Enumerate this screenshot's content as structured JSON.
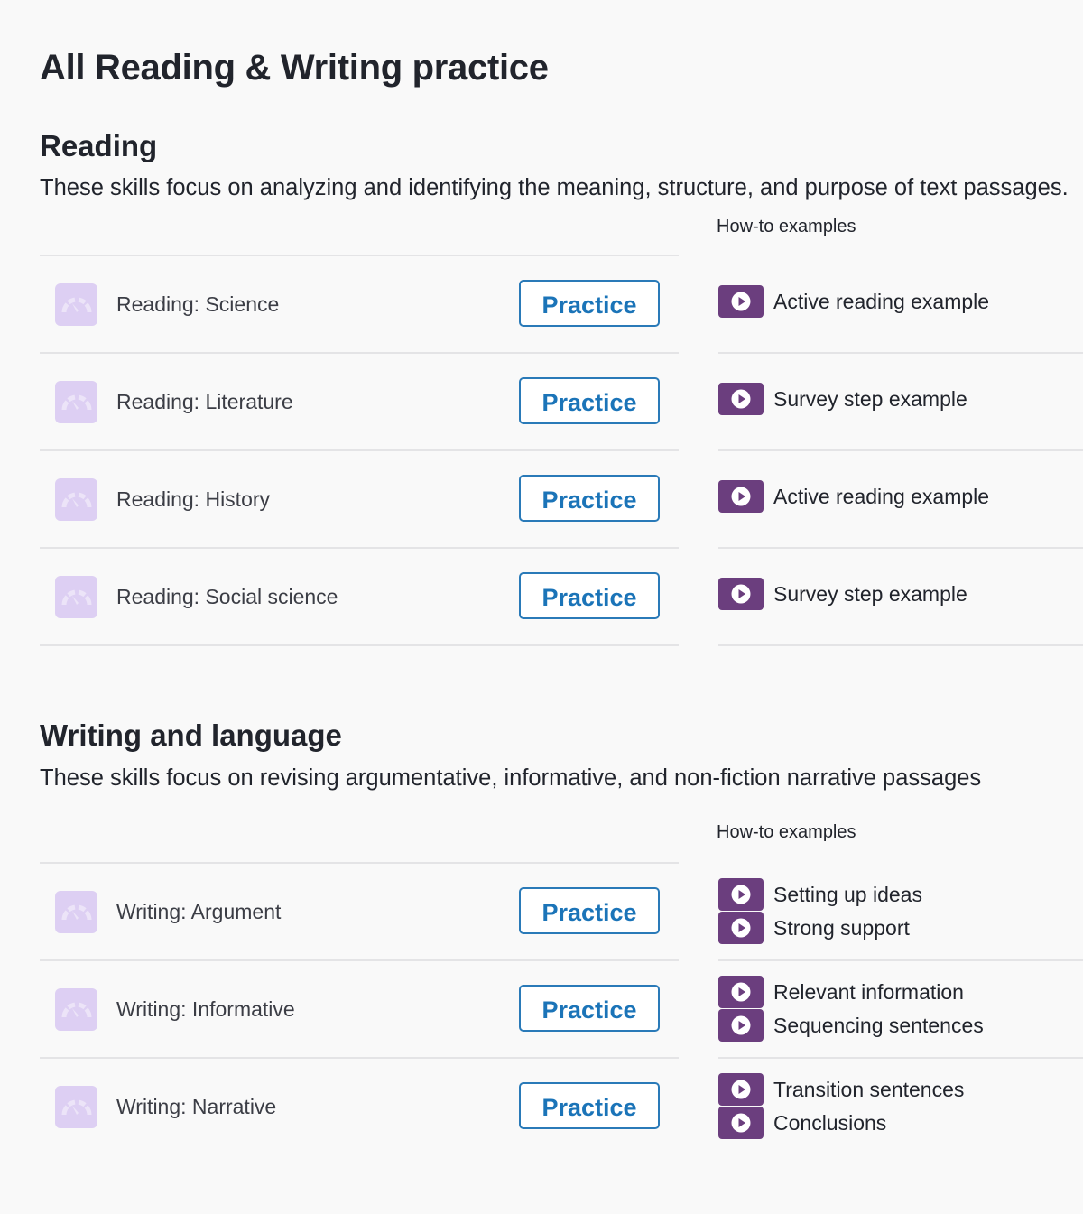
{
  "page": {
    "title": "All Reading & Writing practice"
  },
  "colors": {
    "accent": "#1b74b8",
    "video_badge": "#6b3e7e",
    "skill_icon": "#ddcff3",
    "divider": "#e4e4e6"
  },
  "icons": {
    "skill": "gauge-icon",
    "video": "play-icon"
  },
  "reading": {
    "title": "Reading",
    "description": "These skills focus on analyzing and identifying the meaning, structure, and purpose of text passages.",
    "howto_header": "How-to examples",
    "skills": [
      {
        "name": "Reading: Science",
        "button": "Practice",
        "examples": [
          "Active reading example"
        ]
      },
      {
        "name": "Reading: Literature",
        "button": "Practice",
        "examples": [
          "Survey step example"
        ]
      },
      {
        "name": "Reading: History",
        "button": "Practice",
        "examples": [
          "Active reading example"
        ]
      },
      {
        "name": "Reading: Social science",
        "button": "Practice",
        "examples": [
          "Survey step example"
        ]
      }
    ]
  },
  "writing": {
    "title": "Writing and language",
    "description": "These skills focus on revising argumentative, informative, and non-fiction narrative passages",
    "howto_header": "How-to examples",
    "skills": [
      {
        "name": "Writing: Argument",
        "button": "Practice",
        "examples": [
          "Setting up ideas",
          "Strong support"
        ]
      },
      {
        "name": "Writing: Informative",
        "button": "Practice",
        "examples": [
          "Relevant information",
          "Sequencing sentences"
        ]
      },
      {
        "name": "Writing: Narrative",
        "button": "Practice",
        "examples": [
          "Transition sentences",
          "Conclusions"
        ]
      }
    ]
  }
}
